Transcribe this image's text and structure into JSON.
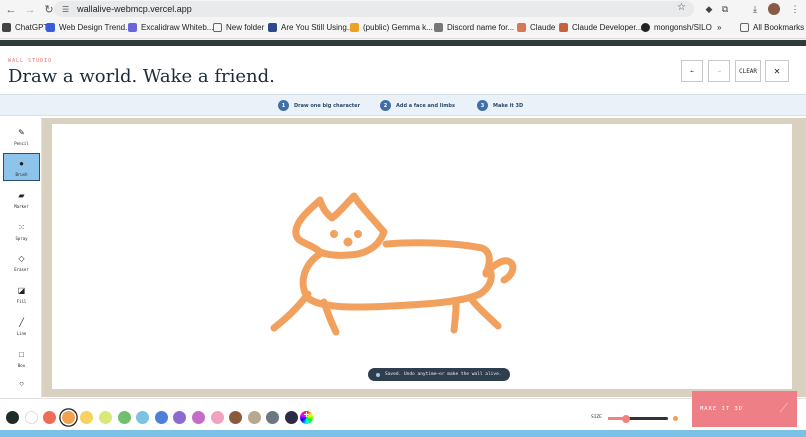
{
  "browser": {
    "url": "wallalive-webmcp.vercel.app",
    "bookmarks": [
      {
        "label": "ChatGPT",
        "color": "#444444"
      },
      {
        "label": "Web Design Trend...",
        "color": "#3b5bdb"
      },
      {
        "label": "Excalidraw Whiteb...",
        "color": "#6965db"
      },
      {
        "label": "New folder",
        "color": "#666666"
      },
      {
        "label": "Are You Still Using...",
        "color": "#2b4a8a"
      },
      {
        "label": "(public) Gemma k...",
        "color": "#f0a020"
      },
      {
        "label": "Discord name for...",
        "color": "#777777"
      },
      {
        "label": "Claude",
        "color": "#d97757"
      },
      {
        "label": "Claude Developer...",
        "color": "#c8623e"
      },
      {
        "label": "mongonsh/SILO",
        "color": "#222222"
      }
    ],
    "more": "»",
    "all_bookmarks": "All Bookmarks"
  },
  "header": {
    "brand": "WALL STUDIO",
    "title": "Draw a world. Wake a friend.",
    "undo": "←",
    "redo": "→",
    "clear": "CLEAR",
    "close": "✕"
  },
  "steps": [
    {
      "num": "1",
      "label": "Draw one big character"
    },
    {
      "num": "2",
      "label": "Add a face and limbs"
    },
    {
      "num": "3",
      "label": "Make it 3D"
    }
  ],
  "tools": [
    {
      "label": "Pencil",
      "icon": "✎"
    },
    {
      "label": "Brush",
      "icon": "●"
    },
    {
      "label": "Marker",
      "icon": "▰"
    },
    {
      "label": "Spray",
      "icon": "⁙"
    },
    {
      "label": "Eraser",
      "icon": "◇"
    },
    {
      "label": "Fill",
      "icon": "◪"
    },
    {
      "label": "Line",
      "icon": "╱"
    },
    {
      "label": "Box",
      "icon": "□"
    }
  ],
  "active_tool": "Brush",
  "toast": "Saved. Undo anytime—or make the wall alive.",
  "palette": [
    "#1f2b2b",
    "#ffffff",
    "#ef6c58",
    "#f0a24f",
    "#f4d35e",
    "#d8e87a",
    "#6fbf6f",
    "#7cc3e3",
    "#4f7fd6",
    "#8c6bd1",
    "#c56cc8",
    "#f0a3c1",
    "#8a5a3c",
    "#b8a890",
    "#6c7780",
    "#2b2b44"
  ],
  "selected_color": "#f0a24f",
  "drawing_color": "#f2a05d",
  "size_label": "SIZE",
  "size_fraction": 0.3,
  "make_it_label": "MAKE IT 3D"
}
